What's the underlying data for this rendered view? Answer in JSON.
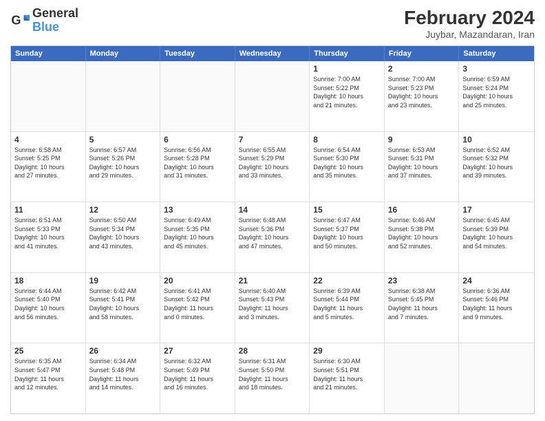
{
  "logo": {
    "line1": "General",
    "line2": "Blue"
  },
  "title": "February 2024",
  "subtitle": "Juybar, Mazandaran, Iran",
  "header_days": [
    "Sunday",
    "Monday",
    "Tuesday",
    "Wednesday",
    "Thursday",
    "Friday",
    "Saturday"
  ],
  "weeks": [
    [
      {
        "day": "",
        "info": ""
      },
      {
        "day": "",
        "info": ""
      },
      {
        "day": "",
        "info": ""
      },
      {
        "day": "",
        "info": ""
      },
      {
        "day": "1",
        "info": "Sunrise: 7:00 AM\nSunset: 5:22 PM\nDaylight: 10 hours\nand 21 minutes."
      },
      {
        "day": "2",
        "info": "Sunrise: 7:00 AM\nSunset: 5:23 PM\nDaylight: 10 hours\nand 23 minutes."
      },
      {
        "day": "3",
        "info": "Sunrise: 6:59 AM\nSunset: 5:24 PM\nDaylight: 10 hours\nand 25 minutes."
      }
    ],
    [
      {
        "day": "4",
        "info": "Sunrise: 6:58 AM\nSunset: 5:25 PM\nDaylight: 10 hours\nand 27 minutes."
      },
      {
        "day": "5",
        "info": "Sunrise: 6:57 AM\nSunset: 5:26 PM\nDaylight: 10 hours\nand 29 minutes."
      },
      {
        "day": "6",
        "info": "Sunrise: 6:56 AM\nSunset: 5:28 PM\nDaylight: 10 hours\nand 31 minutes."
      },
      {
        "day": "7",
        "info": "Sunrise: 6:55 AM\nSunset: 5:29 PM\nDaylight: 10 hours\nand 33 minutes."
      },
      {
        "day": "8",
        "info": "Sunrise: 6:54 AM\nSunset: 5:30 PM\nDaylight: 10 hours\nand 35 minutes."
      },
      {
        "day": "9",
        "info": "Sunrise: 6:53 AM\nSunset: 5:31 PM\nDaylight: 10 hours\nand 37 minutes."
      },
      {
        "day": "10",
        "info": "Sunrise: 6:52 AM\nSunset: 5:32 PM\nDaylight: 10 hours\nand 39 minutes."
      }
    ],
    [
      {
        "day": "11",
        "info": "Sunrise: 6:51 AM\nSunset: 5:33 PM\nDaylight: 10 hours\nand 41 minutes."
      },
      {
        "day": "12",
        "info": "Sunrise: 6:50 AM\nSunset: 5:34 PM\nDaylight: 10 hours\nand 43 minutes."
      },
      {
        "day": "13",
        "info": "Sunrise: 6:49 AM\nSunset: 5:35 PM\nDaylight: 10 hours\nand 45 minutes."
      },
      {
        "day": "14",
        "info": "Sunrise: 6:48 AM\nSunset: 5:36 PM\nDaylight: 10 hours\nand 47 minutes."
      },
      {
        "day": "15",
        "info": "Sunrise: 6:47 AM\nSunset: 5:37 PM\nDaylight: 10 hours\nand 50 minutes."
      },
      {
        "day": "16",
        "info": "Sunrise: 6:46 AM\nSunset: 5:38 PM\nDaylight: 10 hours\nand 52 minutes."
      },
      {
        "day": "17",
        "info": "Sunrise: 6:45 AM\nSunset: 5:39 PM\nDaylight: 10 hours\nand 54 minutes."
      }
    ],
    [
      {
        "day": "18",
        "info": "Sunrise: 6:44 AM\nSunset: 5:40 PM\nDaylight: 10 hours\nand 56 minutes."
      },
      {
        "day": "19",
        "info": "Sunrise: 6:42 AM\nSunset: 5:41 PM\nDaylight: 10 hours\nand 58 minutes."
      },
      {
        "day": "20",
        "info": "Sunrise: 6:41 AM\nSunset: 5:42 PM\nDaylight: 11 hours\nand 0 minutes."
      },
      {
        "day": "21",
        "info": "Sunrise: 6:40 AM\nSunset: 5:43 PM\nDaylight: 11 hours\nand 3 minutes."
      },
      {
        "day": "22",
        "info": "Sunrise: 6:39 AM\nSunset: 5:44 PM\nDaylight: 11 hours\nand 5 minutes."
      },
      {
        "day": "23",
        "info": "Sunrise: 6:38 AM\nSunset: 5:45 PM\nDaylight: 11 hours\nand 7 minutes."
      },
      {
        "day": "24",
        "info": "Sunrise: 6:36 AM\nSunset: 5:46 PM\nDaylight: 11 hours\nand 9 minutes."
      }
    ],
    [
      {
        "day": "25",
        "info": "Sunrise: 6:35 AM\nSunset: 5:47 PM\nDaylight: 11 hours\nand 12 minutes."
      },
      {
        "day": "26",
        "info": "Sunrise: 6:34 AM\nSunset: 5:48 PM\nDaylight: 11 hours\nand 14 minutes."
      },
      {
        "day": "27",
        "info": "Sunrise: 6:32 AM\nSunset: 5:49 PM\nDaylight: 11 hours\nand 16 minutes."
      },
      {
        "day": "28",
        "info": "Sunrise: 6:31 AM\nSunset: 5:50 PM\nDaylight: 11 hours\nand 18 minutes."
      },
      {
        "day": "29",
        "info": "Sunrise: 6:30 AM\nSunset: 5:51 PM\nDaylight: 11 hours\nand 21 minutes."
      },
      {
        "day": "",
        "info": ""
      },
      {
        "day": "",
        "info": ""
      }
    ]
  ]
}
